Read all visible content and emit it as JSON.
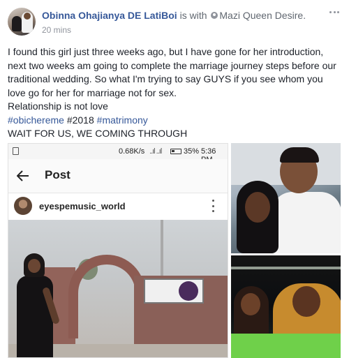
{
  "post": {
    "author": "Obinna Ohajianya DE LatiBoi",
    "with_text": "is with",
    "tagged_friend": "Mazi Queen Desire.",
    "timestamp": "20 mins",
    "lines": [
      "I found this girl just three weeks ago, but I have gone for her introduction, next two weeks am going to complete the marriage journey steps before our traditional wedding. So what I'm trying to say GUYS if you see whom you love go for her for marriage not for sex.",
      "Relationship is not love"
    ],
    "hashtag_line": {
      "tag1": "#obichereme",
      "plain": " #2018 ",
      "tag2": "#matrimony"
    },
    "closing": "WAIT FOR US, WE COMING THROUGH"
  },
  "screenshot": {
    "network_speed": "0.68K/s",
    "signal": "..ıl ..ıl",
    "battery": "35%",
    "time": "5:36 PM",
    "app_bar_title": "Post",
    "username": "eyespemusic_world"
  },
  "icons": {
    "back": "back-arrow-icon",
    "more": "more-vertical-icon",
    "options": "more-horizontal-icon",
    "tag": "location-tag-icon"
  }
}
